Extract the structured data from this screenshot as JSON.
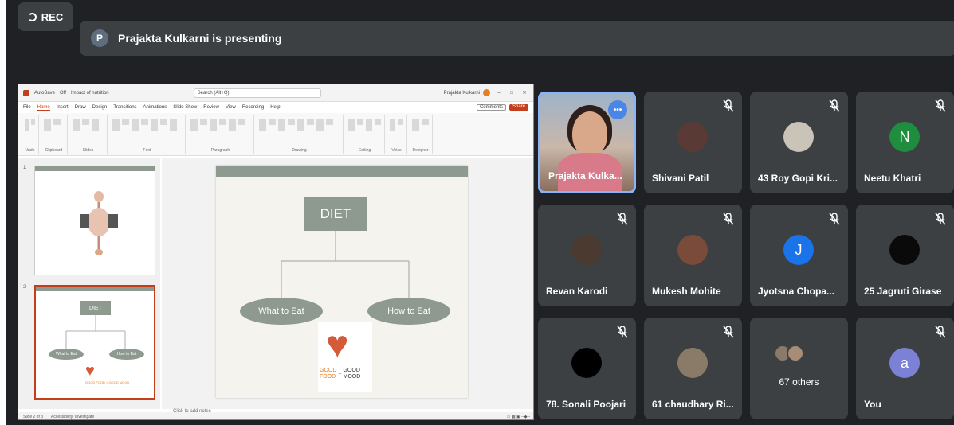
{
  "recording": {
    "label": "REC"
  },
  "presenting": {
    "avatar_letter": "P",
    "text": "Prajakta Kulkarni is presenting"
  },
  "ppt": {
    "title_bar": {
      "autosave": "AutoSave",
      "autosave_state": "Off",
      "file_name": "Impact of nutrition",
      "search_placeholder": "Search (Alt+Q)",
      "user": "Prajakta Kulkarni"
    },
    "menu": [
      "File",
      "Home",
      "Insert",
      "Draw",
      "Design",
      "Transitions",
      "Animations",
      "Slide Show",
      "Review",
      "View",
      "Recording",
      "Help"
    ],
    "menu_active": "Home",
    "comments_label": "Comments",
    "share_label": "Share",
    "ribbon_groups": [
      "Undo",
      "Clipboard",
      "Slides",
      "Font",
      "Paragraph",
      "Drawing",
      "Editing",
      "Voice",
      "Designer"
    ],
    "thumbs": [
      {
        "num": "1"
      },
      {
        "num": "2",
        "diet": "DIET",
        "left": "What to Eat",
        "right": "How to Eat",
        "caption": "GOOD FOOD = GOOD MOOD"
      }
    ],
    "slide": {
      "title": "DIET",
      "left_oval": "What to Eat",
      "right_oval": "How to Eat",
      "good1": "GOOD",
      "food": "FOOD",
      "equals": "=",
      "good2": "GOOD",
      "mood": "MOOD"
    },
    "notes_placeholder": "Click to add notes",
    "status": {
      "slide_count": "Slide 2 of 3",
      "accessibility": "Accessibility: Investigate"
    },
    "colors": {
      "accent": "#c43e1c",
      "shape": "#8e9a8f"
    }
  },
  "participants": [
    {
      "name": "Prajakta Kulka...",
      "type": "speaker",
      "muted": false
    },
    {
      "name": "Shivani Patil",
      "type": "photo",
      "muted": true,
      "color": "#5a3a34"
    },
    {
      "name": "43 Roy Gopi Kri...",
      "type": "photo",
      "muted": true,
      "color": "#c9c3b8"
    },
    {
      "name": "Neetu Khatri",
      "type": "letter",
      "letter": "N",
      "muted": true,
      "color": "#1e8e3e"
    },
    {
      "name": "Revan Karodi",
      "type": "photo",
      "muted": true,
      "color": "#4a3a30"
    },
    {
      "name": "Mukesh Mohite",
      "type": "photo",
      "muted": true,
      "color": "#7a4a3a"
    },
    {
      "name": "Jyotsna Chopa...",
      "type": "letter",
      "letter": "J",
      "muted": true,
      "color": "#1a73e8"
    },
    {
      "name": "25 Jagruti Girase",
      "type": "photo",
      "muted": true,
      "color": "#0a0a0a"
    },
    {
      "name": "78. Sonali Poojari",
      "type": "photo",
      "muted": true,
      "color": "#000000"
    },
    {
      "name": "61 chaudhary Ri...",
      "type": "photo",
      "muted": true,
      "color": "#8a7a68"
    },
    {
      "name": "67 others",
      "type": "others",
      "muted": false
    },
    {
      "name": "You",
      "type": "letter",
      "letter": "a",
      "muted": true,
      "color": "#7b82d6"
    }
  ],
  "mic_off_icon": "mic-off-icon"
}
